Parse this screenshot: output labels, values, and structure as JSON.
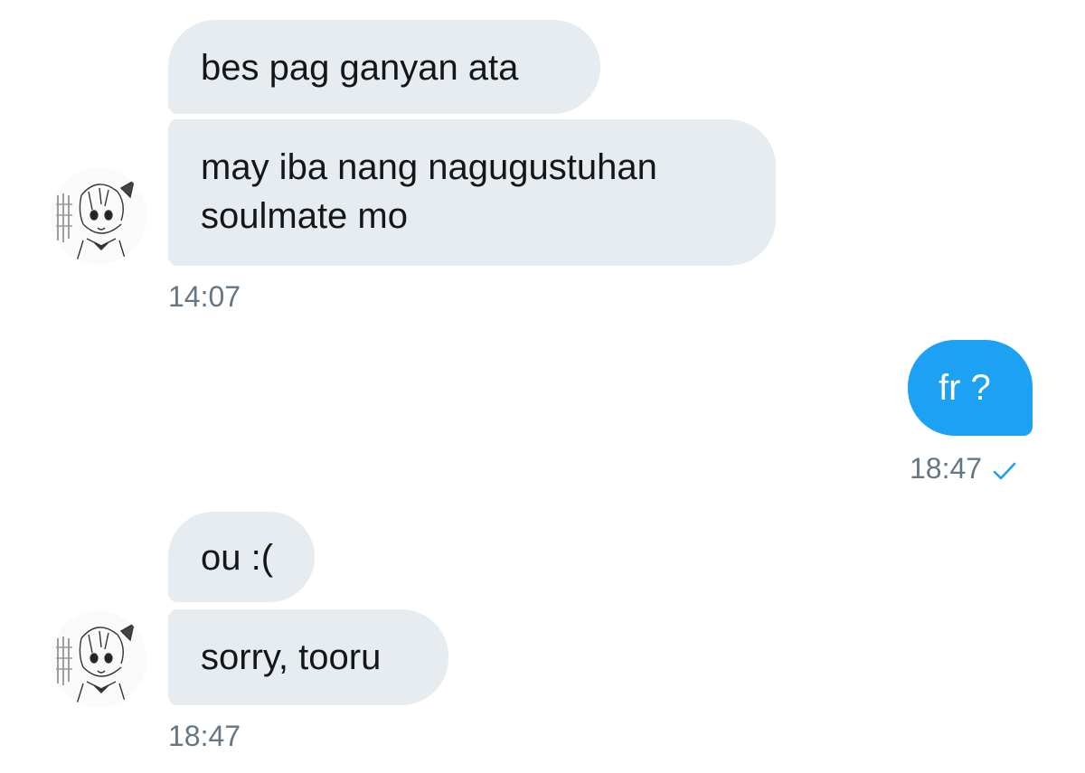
{
  "conversation": {
    "group1": {
      "messages": [
        "bes pag ganyan ata",
        "may iba nang nagugustuhan",
        "soulmate mo"
      ],
      "time": "14:07"
    },
    "outgoing": {
      "message": "fr ?",
      "time": "18:47",
      "status_icon": "checkmark-icon"
    },
    "group2": {
      "messages": [
        "ou :(",
        "sorry, tooru"
      ],
      "time": "18:47"
    }
  },
  "colors": {
    "incoming_bubble": "#e6ecf0",
    "outgoing_bubble": "#1da1f2",
    "timestamp": "#657786",
    "check": "#1da1f2"
  },
  "avatar_icon": "anime-avatar-icon"
}
